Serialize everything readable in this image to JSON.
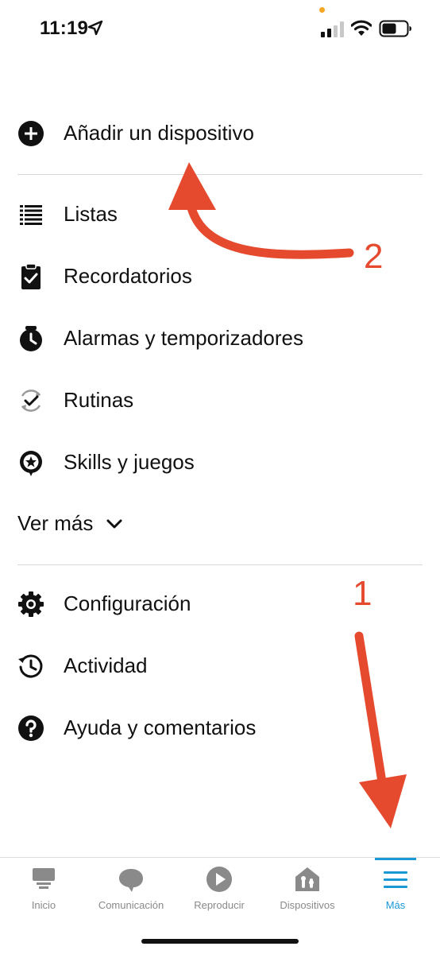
{
  "status_bar": {
    "time": "11:19",
    "icons": [
      "location-arrow-icon",
      "cellular-signal-icon",
      "wifi-icon",
      "battery-icon"
    ],
    "orange_dot_color": "#f5a623"
  },
  "menu": {
    "add_device": "Añadir un dispositivo",
    "items": [
      {
        "label": "Listas",
        "icon": "list-icon"
      },
      {
        "label": "Recordatorios",
        "icon": "clipboard-check-icon"
      },
      {
        "label": "Alarmas y temporizadores",
        "icon": "alarm-clock-icon"
      },
      {
        "label": "Rutinas",
        "icon": "routine-cycle-icon"
      },
      {
        "label": "Skills y juegos",
        "icon": "skills-star-icon"
      }
    ],
    "see_more": "Ver más",
    "settings_items": [
      {
        "label": "Configuración",
        "icon": "gear-icon"
      },
      {
        "label": "Actividad",
        "icon": "history-icon"
      },
      {
        "label": "Ayuda y comentarios",
        "icon": "help-icon"
      }
    ]
  },
  "annotations": {
    "arrow_color": "#e64a2e",
    "step_1": "1",
    "step_2": "2"
  },
  "tab_bar": {
    "active_color": "#1a98d5",
    "tabs": [
      {
        "label": "Inicio",
        "icon": "home-icon"
      },
      {
        "label": "Comunicación",
        "icon": "chat-bubble-icon"
      },
      {
        "label": "Reproducir",
        "icon": "play-icon"
      },
      {
        "label": "Dispositivos",
        "icon": "devices-house-icon"
      },
      {
        "label": "Más",
        "icon": "hamburger-menu-icon",
        "active": true
      }
    ]
  }
}
